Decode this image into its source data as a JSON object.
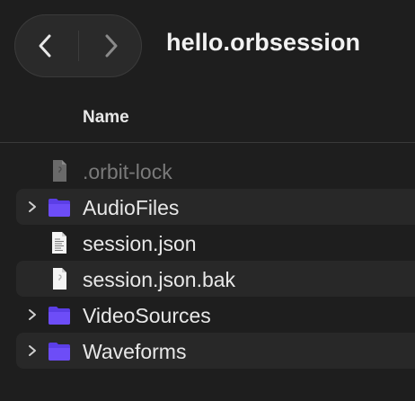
{
  "window": {
    "title": "hello.orbsession"
  },
  "toolbar": {
    "back_icon": "chevron-left-icon",
    "forward_icon": "chevron-right-icon"
  },
  "columns": {
    "name": "Name"
  },
  "files": [
    {
      "name": ".orbit-lock",
      "kind": "file",
      "icon": "generic-file-icon",
      "hidden": true
    },
    {
      "name": "AudioFiles",
      "kind": "folder",
      "icon": "folder-icon",
      "expandable": true
    },
    {
      "name": "session.json",
      "kind": "file",
      "icon": "text-file-icon"
    },
    {
      "name": "session.json.bak",
      "kind": "file",
      "icon": "generic-file-icon"
    },
    {
      "name": "VideoSources",
      "kind": "folder",
      "icon": "folder-icon",
      "expandable": true
    },
    {
      "name": "Waveforms",
      "kind": "folder",
      "icon": "folder-icon",
      "expandable": true
    }
  ],
  "colors": {
    "background": "#1e1e1e",
    "alt_row": "#282828",
    "folder": "#6d4df7",
    "text": "#e8e8e8",
    "dim_text": "#7a7a7a"
  }
}
